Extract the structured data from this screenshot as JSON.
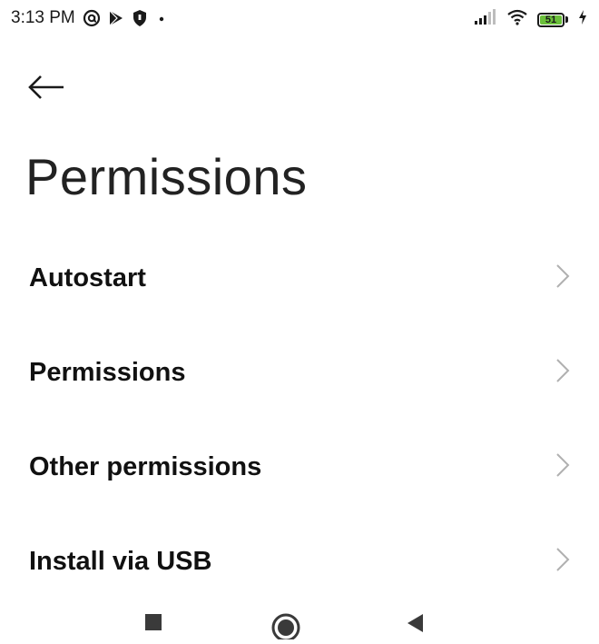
{
  "status_bar": {
    "time": "3:13 PM",
    "icons": [
      "at-sign-icon",
      "play-store-icon",
      "shield-icon",
      "dot-icon"
    ],
    "right_icons": [
      "signal-icon",
      "wifi-icon",
      "battery-icon",
      "charging-icon"
    ],
    "battery_level": "51"
  },
  "header": {
    "back_icon": "back-arrow-icon",
    "title": "Permissions"
  },
  "list": {
    "items": [
      {
        "label": "Autostart",
        "icon": "chevron-right-icon"
      },
      {
        "label": "Permissions",
        "icon": "chevron-right-icon"
      },
      {
        "label": "Other permissions",
        "icon": "chevron-right-icon"
      },
      {
        "label": "Install via USB",
        "icon": "chevron-right-icon"
      }
    ]
  },
  "nav_bar": {
    "buttons": [
      "recents-button",
      "home-button",
      "back-button"
    ]
  },
  "colors": {
    "background": "#ffffff",
    "text": "#111111",
    "chevron": "#b0b0b0",
    "battery_fill": "#6abf3a"
  }
}
